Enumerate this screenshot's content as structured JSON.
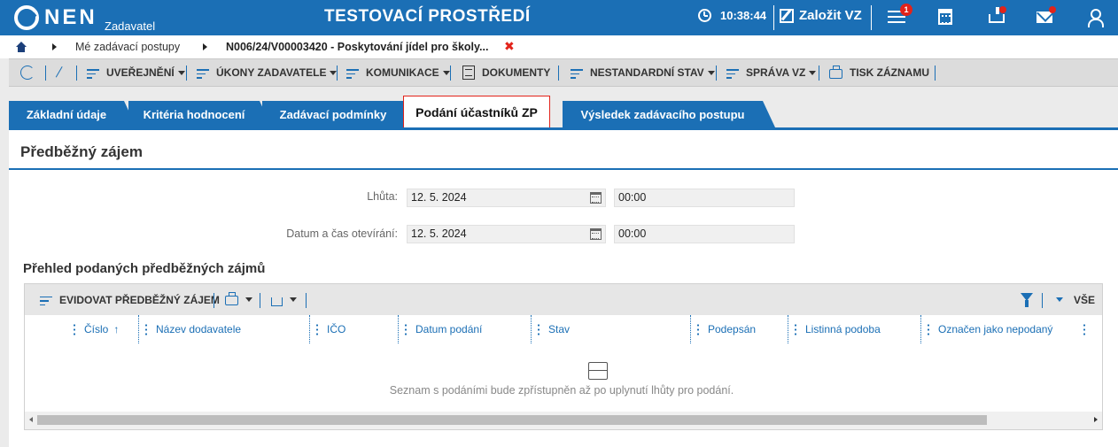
{
  "header": {
    "logo_text": "NEN",
    "logo_sub": "Zadavatel",
    "environment_title": "TESTOVACÍ PROSTŘEDÍ",
    "clock": "10:38:44",
    "create_label": "Založit VZ",
    "notifications_badge": "1",
    "colors": {
      "bar": "#1b6fb5",
      "badge": "#e2231a"
    }
  },
  "breadcrumb": {
    "items": [
      "Mé zadávací postupy",
      "N006/24/V00003420 - Poskytování jídel pro školy..."
    ],
    "close_icon": "close-icon"
  },
  "toolbar": {
    "uverejneni": "UVEŘEJNĚNÍ",
    "ukony": "ÚKONY ZADAVATELE",
    "komunikace": "KOMUNIKACE",
    "dokumenty": "DOKUMENTY",
    "nestandardni": "NESTANDARDNÍ STAV",
    "sprava": "SPRÁVA VZ",
    "tisk": "TISK ZÁZNAMU"
  },
  "tabs": [
    {
      "label": "Základní údaje",
      "active": false
    },
    {
      "label": "Kritéria hodnocení",
      "active": false
    },
    {
      "label": "Zadávací podmínky",
      "active": false
    },
    {
      "label": "Podání účastníků ZP",
      "active": true
    },
    {
      "label": "Výsledek zadávacího postupu",
      "active": false
    }
  ],
  "section": {
    "title": "Předběžný zájem",
    "lhuta_label": "Lhůta:",
    "lhuta_date": "12. 5. 2024",
    "lhuta_time": "00:00",
    "otevirani_label": "Datum a čas otevírání:",
    "otevirani_date": "12. 5. 2024",
    "otevirani_time": "00:00"
  },
  "grid": {
    "title": "Přehled podaných předběžných zájmů",
    "evidovat_label": "EVIDOVAT PŘEDBĚŽNÝ ZÁJEM",
    "filter_all_label": "VŠE",
    "columns": [
      "Číslo",
      "Název dodavatele",
      "IČO",
      "Datum podání",
      "Stav",
      "Podepsán",
      "Listinná podoba",
      "Označen jako nepodaný"
    ],
    "sort_indicator": "↑",
    "empty_message": "Seznam s podáními bude zpřístupněn až po uplynutí lhůty pro podání."
  }
}
